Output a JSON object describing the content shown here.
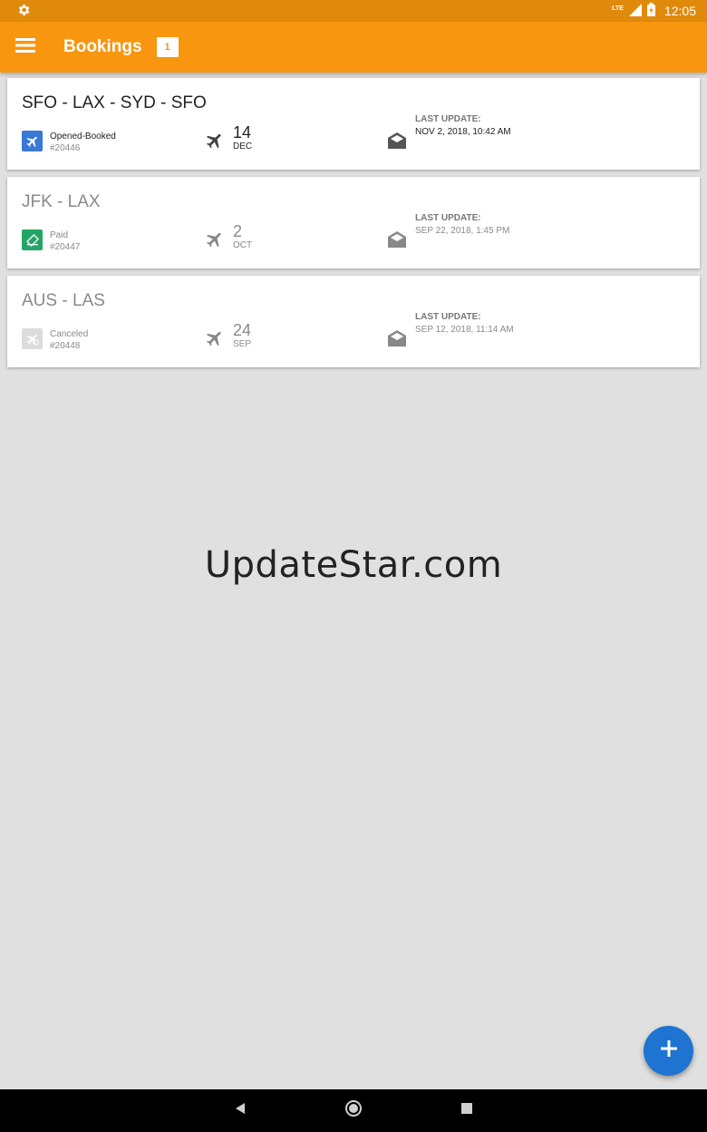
{
  "status_bar": {
    "time": "12:05",
    "network": "LTE",
    "settings_icon": "gear-icon",
    "battery_icon": "battery-charging-icon"
  },
  "app_bar": {
    "title": "Bookings",
    "badge_count": "1",
    "menu_icon": "hamburger-icon",
    "background_color": "#f8960f"
  },
  "bookings": [
    {
      "route": "SFO - LAX - SYD - SFO",
      "status": "Opened-Booked",
      "status_color": "#3a78d8",
      "booking_id": "#20446",
      "day": "14",
      "month": "DEC",
      "last_update_label": "LAST UPDATE:",
      "last_update": "NOV 2, 2018, 10:42 AM"
    },
    {
      "route": "JFK - LAX",
      "status": "Paid",
      "status_color": "#24a566",
      "booking_id": "#20447",
      "day": "2",
      "month": "OCT",
      "last_update_label": "LAST UPDATE:",
      "last_update": "SEP 22, 2018, 1:45 PM"
    },
    {
      "route": "AUS - LAS",
      "status": "Canceled",
      "status_color": "#dcdcdc",
      "booking_id": "#20448",
      "day": "24",
      "month": "SEP",
      "last_update_label": "LAST UPDATE:",
      "last_update": "SEP 12, 2018, 11:14 AM"
    }
  ],
  "watermark": "UpdateStar.com",
  "fab": {
    "icon": "plus-icon",
    "color": "#1e74d0"
  },
  "nav_bar": {
    "back_icon": "back-icon",
    "home_icon": "home-icon",
    "recents_icon": "recents-icon"
  }
}
